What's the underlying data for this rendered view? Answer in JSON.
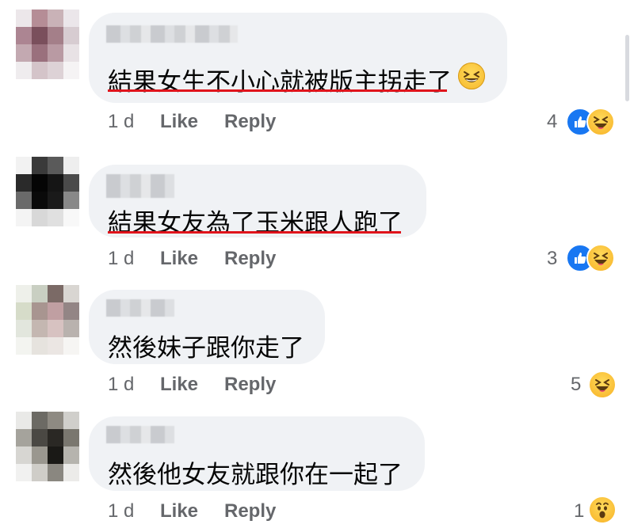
{
  "comments": [
    {
      "text": "結果女生不小心就被版主拐走了",
      "time": "1 d",
      "like_label": "Like",
      "reply_label": "Reply",
      "reaction_count": "4",
      "reactions": [
        "like",
        "haha"
      ],
      "inline_emoji": "grinning-squinting-face",
      "underlined": true
    },
    {
      "text": "結果女友為了玉米跟人跑了",
      "time": "1 d",
      "like_label": "Like",
      "reply_label": "Reply",
      "reaction_count": "3",
      "reactions": [
        "like",
        "haha"
      ],
      "underlined": true
    },
    {
      "text": "然後妹子跟你走了",
      "time": "1 d",
      "like_label": "Like",
      "reply_label": "Reply",
      "reaction_count": "5",
      "reactions": [
        "haha"
      ],
      "underlined": false
    },
    {
      "text": "然後他女友就跟你在一起了",
      "time": "1 d",
      "like_label": "Like",
      "reply_label": "Reply",
      "reaction_count": "1",
      "reactions": [
        "wow"
      ],
      "underlined": false
    }
  ],
  "colors": {
    "bubble": "#f0f2f5",
    "meta_text": "#65676b",
    "underline": "#e0141c",
    "like_blue": "#1877f2",
    "emoji_yellow": "#f7b125"
  }
}
